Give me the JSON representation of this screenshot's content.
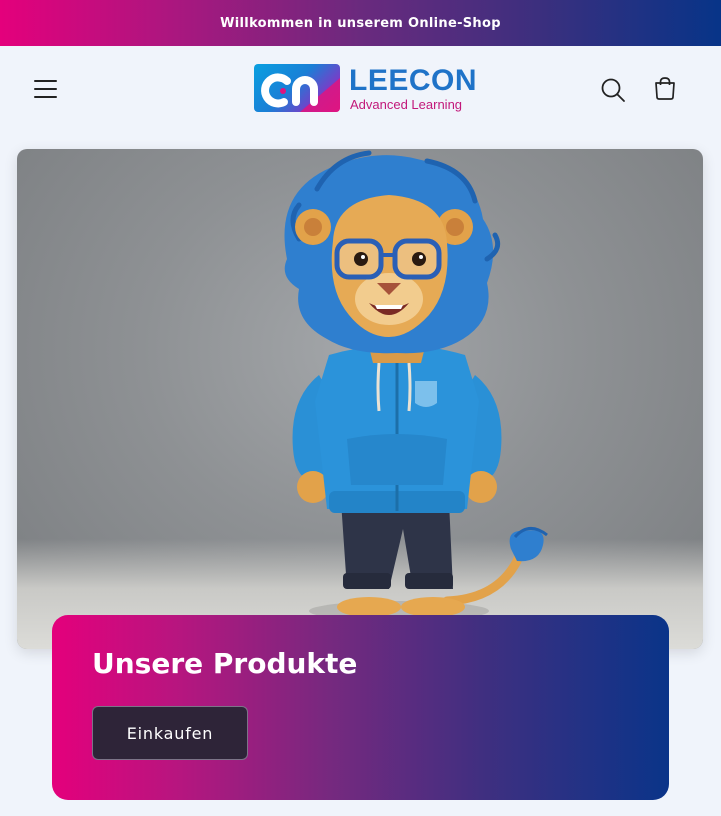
{
  "announcement": {
    "text": "Willkommen in unserem Online-Shop"
  },
  "header": {
    "menu_icon": "hamburger-menu-icon",
    "search_icon": "search-icon",
    "cart_icon": "cart-icon",
    "logo": {
      "name": "LEECON",
      "tagline": "Advanced Learning"
    }
  },
  "hero": {
    "image": "lion-mascot-blue-hoodie"
  },
  "banner": {
    "title": "Unsere Produkte",
    "button_label": "Einkaufen"
  },
  "colors": {
    "brand_pink": "#e4007c",
    "brand_blue": "#0a3489",
    "logo_blue": "#1f73c8",
    "button_dark": "#2e2438",
    "page_bg": "#f0f4fb"
  }
}
